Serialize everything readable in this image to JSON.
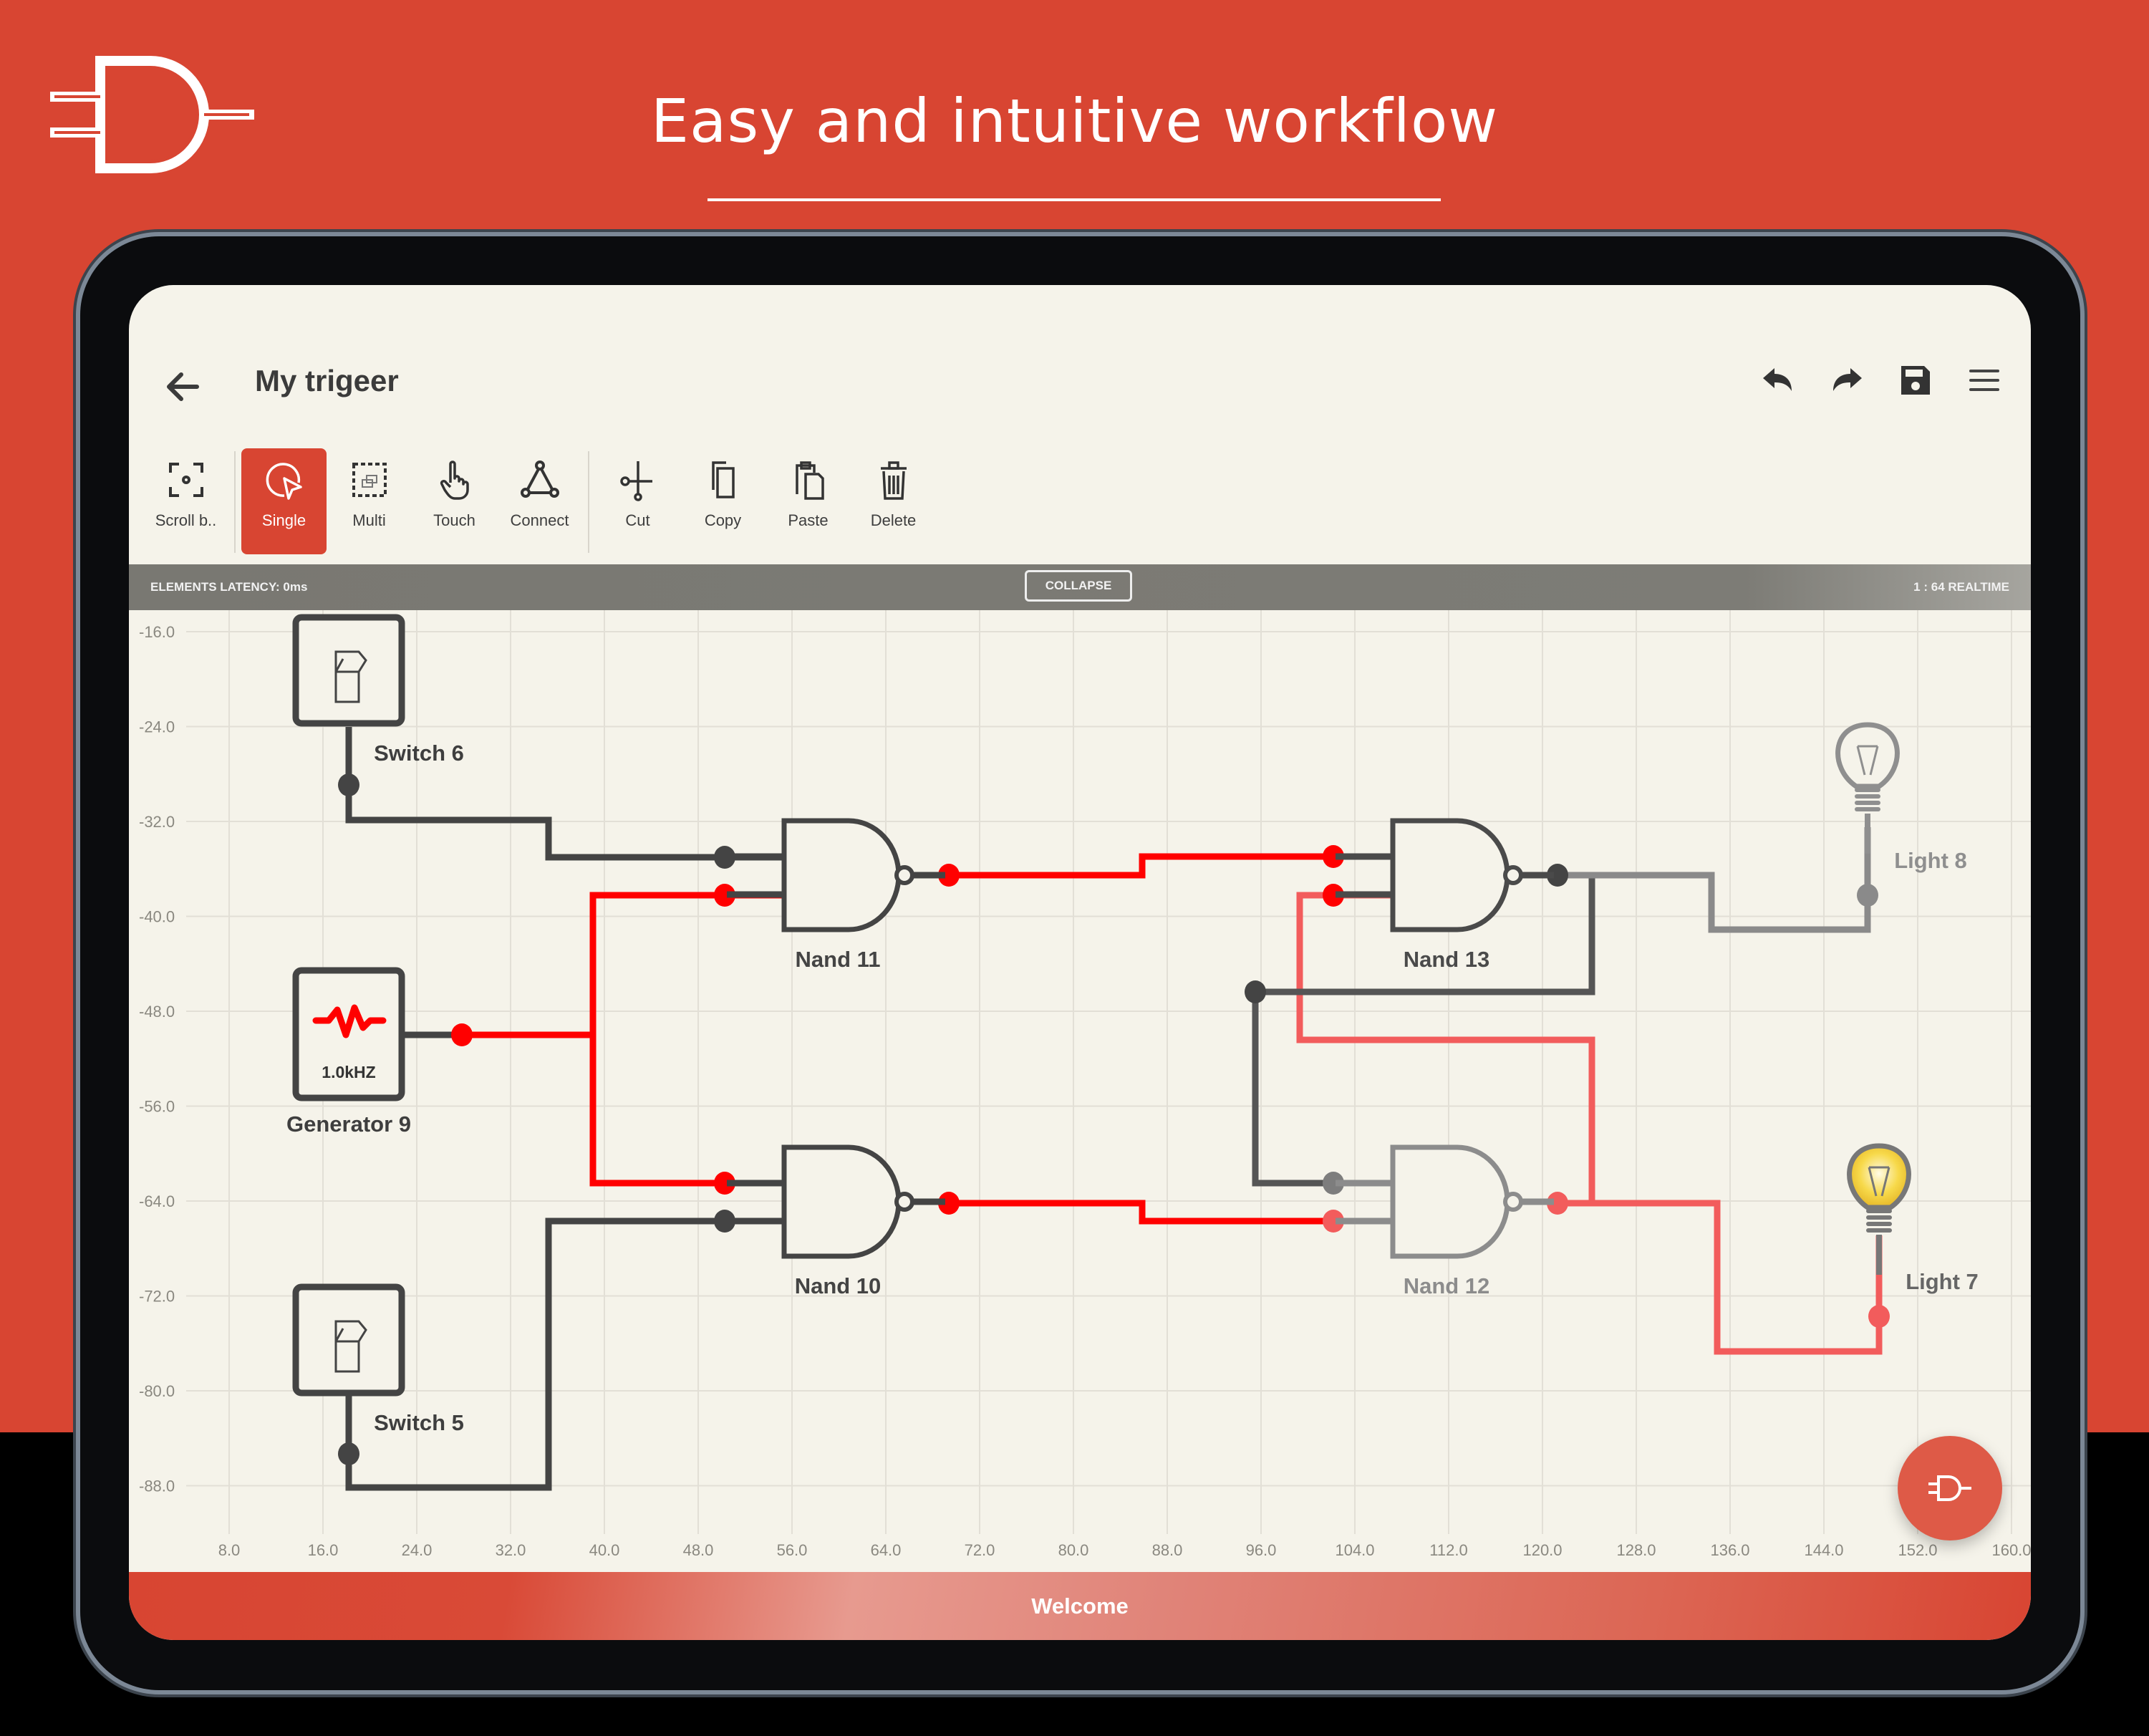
{
  "promo": {
    "headline": "Easy and intuitive workflow",
    "brand_color": "#D84532"
  },
  "app": {
    "title": "My trigeer",
    "header_actions": [
      {
        "name": "undo",
        "icon": "undo-icon"
      },
      {
        "name": "redo",
        "icon": "redo-icon"
      },
      {
        "name": "save",
        "icon": "save-icon"
      },
      {
        "name": "menu",
        "icon": "menu-icon"
      }
    ],
    "toolbar": [
      {
        "label": "Scroll b..",
        "icon": "scroll-icon",
        "active": false
      },
      {
        "label": "Single",
        "icon": "single-select-icon",
        "active": true
      },
      {
        "label": "Multi",
        "icon": "multi-select-icon",
        "active": false
      },
      {
        "label": "Touch",
        "icon": "touch-icon",
        "active": false
      },
      {
        "label": "Connect",
        "icon": "connect-icon",
        "active": false
      },
      {
        "label": "Cut",
        "icon": "cut-icon",
        "active": false
      },
      {
        "label": "Copy",
        "icon": "copy-icon",
        "active": false
      },
      {
        "label": "Paste",
        "icon": "paste-icon",
        "active": false
      },
      {
        "label": "Delete",
        "icon": "delete-icon",
        "active": false
      }
    ],
    "status": {
      "latency": "ELEMENTS LATENCY: 0ms",
      "collapse": "COLLAPSE",
      "speed": "1 : 64 REALTIME"
    },
    "footer": "Welcome"
  },
  "canvas": {
    "x_ticks": [
      "8.0",
      "16.0",
      "24.0",
      "32.0",
      "40.0",
      "48.0",
      "56.0",
      "64.0",
      "72.0",
      "80.0",
      "88.0",
      "96.0",
      "104.0",
      "112.0",
      "120.0",
      "128.0",
      "136.0",
      "144.0",
      "152.0",
      "160.0"
    ],
    "y_ticks": [
      "-16.0",
      "-24.0",
      "-32.0",
      "-40.0",
      "-48.0",
      "-56.0",
      "-64.0",
      "-72.0",
      "-80.0",
      "-88.0"
    ],
    "components": [
      {
        "id": "switch6",
        "type": "switch",
        "label": "Switch 6"
      },
      {
        "id": "gen9",
        "type": "generator",
        "label": "Generator 9",
        "frequency": "1.0kHZ"
      },
      {
        "id": "switch5",
        "type": "switch",
        "label": "Switch 5"
      },
      {
        "id": "nand11",
        "type": "nand",
        "label": "Nand 11"
      },
      {
        "id": "nand10",
        "type": "nand",
        "label": "Nand 10"
      },
      {
        "id": "nand13",
        "type": "nand",
        "label": "Nand 13"
      },
      {
        "id": "nand12",
        "type": "nand",
        "label": "Nand 12"
      },
      {
        "id": "light8",
        "type": "light",
        "label": "Light 8",
        "on": false
      },
      {
        "id": "light7",
        "type": "light",
        "label": "Light 7",
        "on": true
      }
    ],
    "colors": {
      "wire_high": "#FF0000",
      "wire_low": "#444444",
      "grid": "#e2dfd6"
    }
  }
}
